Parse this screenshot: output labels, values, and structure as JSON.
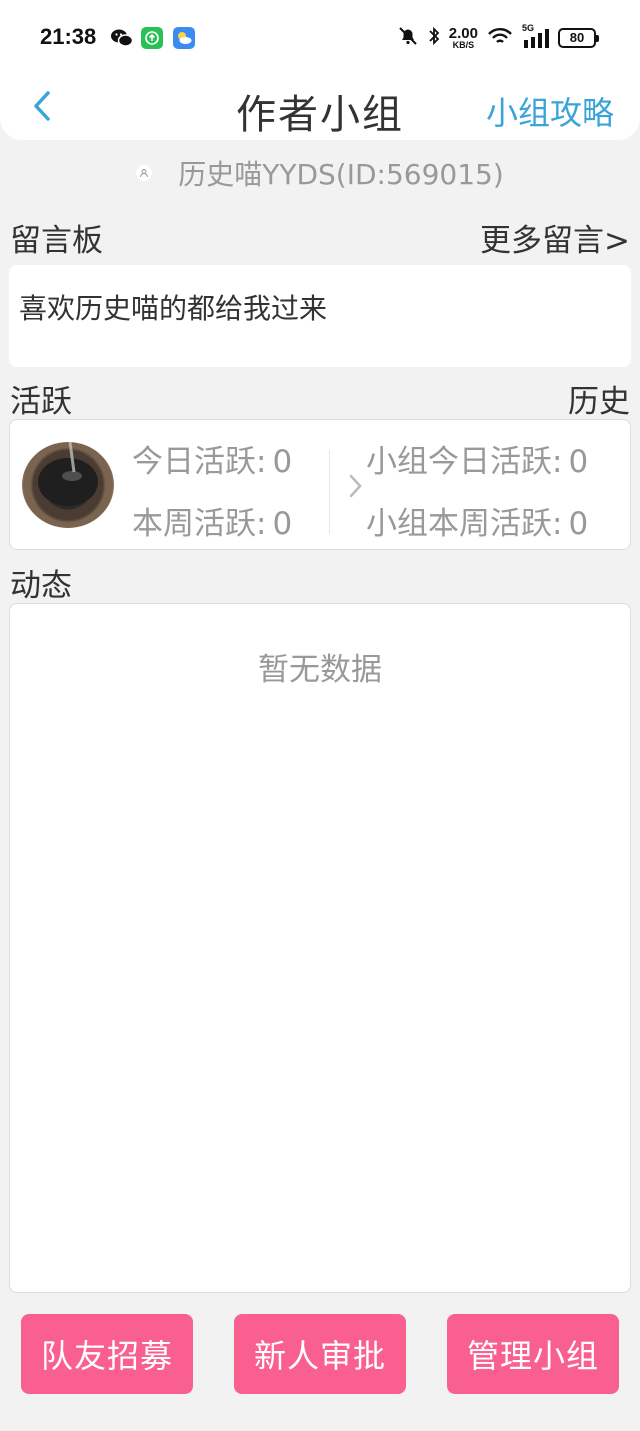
{
  "status_bar": {
    "time": "21:38",
    "net_speed": "2.00",
    "net_unit": "KB/S",
    "signal_label": "5G",
    "battery": "80",
    "icons": [
      "wechat-icon",
      "green-app-icon",
      "weather-icon",
      "mute-icon",
      "bluetooth-icon",
      "wifi-icon",
      "signal-icon",
      "battery-icon"
    ]
  },
  "nav": {
    "back_icon": "chevron-left-icon",
    "title": "作者小组",
    "right_link": "小组攻略"
  },
  "user": {
    "id_text": "历史喵YYDS(ID:569015)"
  },
  "message_board": {
    "title": "留言板",
    "more": "更多留言>",
    "content": "喜欢历史喵的都给我过来"
  },
  "activity": {
    "title": "活跃",
    "history": "历史",
    "today_label": "今日活跃:",
    "today_value": "0",
    "week_label": "本周活跃:",
    "week_value": "0",
    "group_today_label": "小组今日活跃:",
    "group_today_value": "0",
    "group_week_label": "小组本周活跃:",
    "group_week_value": "0"
  },
  "feed": {
    "title": "动态",
    "empty": "暂无数据"
  },
  "buttons": {
    "recruit": "队友招募",
    "approve": "新人审批",
    "manage": "管理小组"
  },
  "colors": {
    "accent_blue": "#3aa4d9",
    "button_pink": "#fa608f",
    "background": "#f2f2f2",
    "muted_text": "#999999"
  }
}
